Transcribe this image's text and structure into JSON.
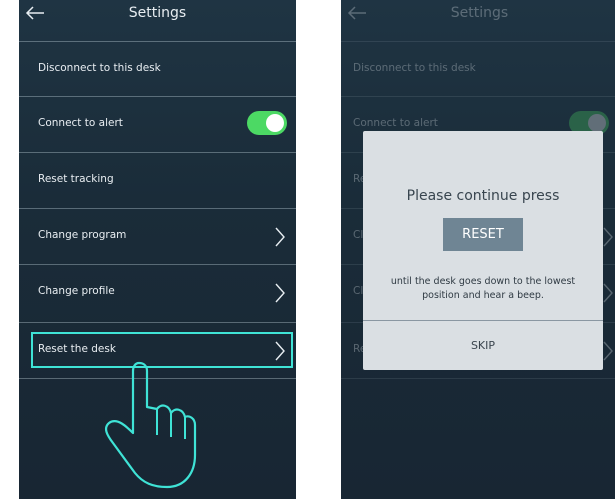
{
  "left_screen": {
    "header": {
      "title": "Settings",
      "back_icon": "arrow-left-icon"
    },
    "rows": [
      {
        "label": "Disconnect to this desk"
      },
      {
        "label": "Connect to alert",
        "toggle_on": true
      },
      {
        "label": "Reset tracking"
      },
      {
        "label": "Change program",
        "chevron": true
      },
      {
        "label": "Change profile",
        "chevron": true
      },
      {
        "label": "Reset the desk",
        "chevron": true,
        "highlighted": true
      }
    ],
    "overlay_icon": "tap-hand-icon"
  },
  "right_screen": {
    "header": {
      "title": "Settings",
      "back_icon": "arrow-left-icon"
    },
    "rows": [
      {
        "label": "Disconnect to this desk"
      },
      {
        "label": "Connect to alert"
      },
      {
        "label": "Re"
      },
      {
        "label": "Cl"
      },
      {
        "label": "Cl"
      },
      {
        "label": "Re"
      }
    ],
    "dialog": {
      "title": "Please continue press",
      "button": "RESET",
      "message": "until the desk goes down to the lowest position and hear a beep.",
      "skip": "SKIP"
    }
  },
  "colors": {
    "accent_toggle": "#4cd964",
    "highlight": "#3fe3d6",
    "background": "#1c2f3c"
  }
}
